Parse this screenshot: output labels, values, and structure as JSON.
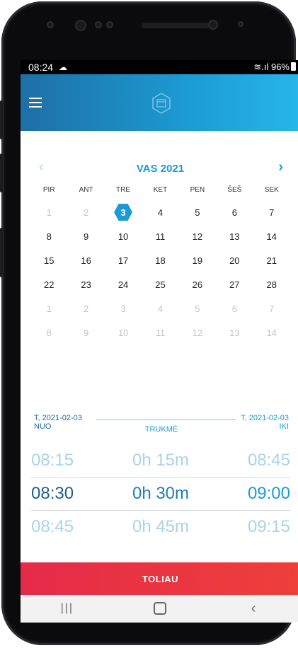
{
  "status_bar": {
    "time": "08:24",
    "weather_icon": "cloud-sun-icon",
    "battery": "96%",
    "signal": "wifi-signal-icon"
  },
  "app_bar": {
    "menu_icon": "hamburger-menu-icon",
    "logo_icon": "hexagon-calendar-icon",
    "color_start": "#1e6fa6",
    "color_end": "#27b6ea"
  },
  "calendar": {
    "title": "VAS 2021",
    "prev_icon": "chevron-left-icon",
    "next_icon": "chevron-right-icon",
    "weekdays": [
      "PIR",
      "ANT",
      "TRE",
      "KET",
      "PEN",
      "ŠEŠ",
      "SEK"
    ],
    "weeks": [
      [
        "1",
        "2",
        "3",
        "4",
        "5",
        "6",
        "7"
      ],
      [
        "8",
        "9",
        "10",
        "11",
        "12",
        "13",
        "14"
      ],
      [
        "15",
        "16",
        "17",
        "18",
        "19",
        "20",
        "21"
      ],
      [
        "22",
        "23",
        "24",
        "25",
        "26",
        "27",
        "28"
      ],
      [
        "1",
        "2",
        "3",
        "4",
        "5",
        "6",
        "7"
      ],
      [
        "8",
        "9",
        "10",
        "11",
        "12",
        "13",
        "14"
      ]
    ],
    "selected_day": "3",
    "accent": "#1c9bd3"
  },
  "time_range": {
    "start_date": "T, 2021-02-03",
    "end_date": "T, 2021-02-03",
    "from_label": "NUO",
    "duration_label": "TRUKMĖ",
    "to_label": "IKI",
    "rows": [
      {
        "start": "08:15",
        "duration": "0h 15m",
        "end": "08:45"
      },
      {
        "start": "08:30",
        "duration": "0h 30m",
        "end": "09:00"
      },
      {
        "start": "08:45",
        "duration": "0h 45m",
        "end": "09:15"
      }
    ],
    "selected_index": 1
  },
  "cta": {
    "label": "TOLIAU",
    "color": "#e62a49"
  },
  "system_nav": {
    "recents_icon": "recents-icon",
    "home_icon": "home-icon",
    "back_icon": "back-icon"
  }
}
